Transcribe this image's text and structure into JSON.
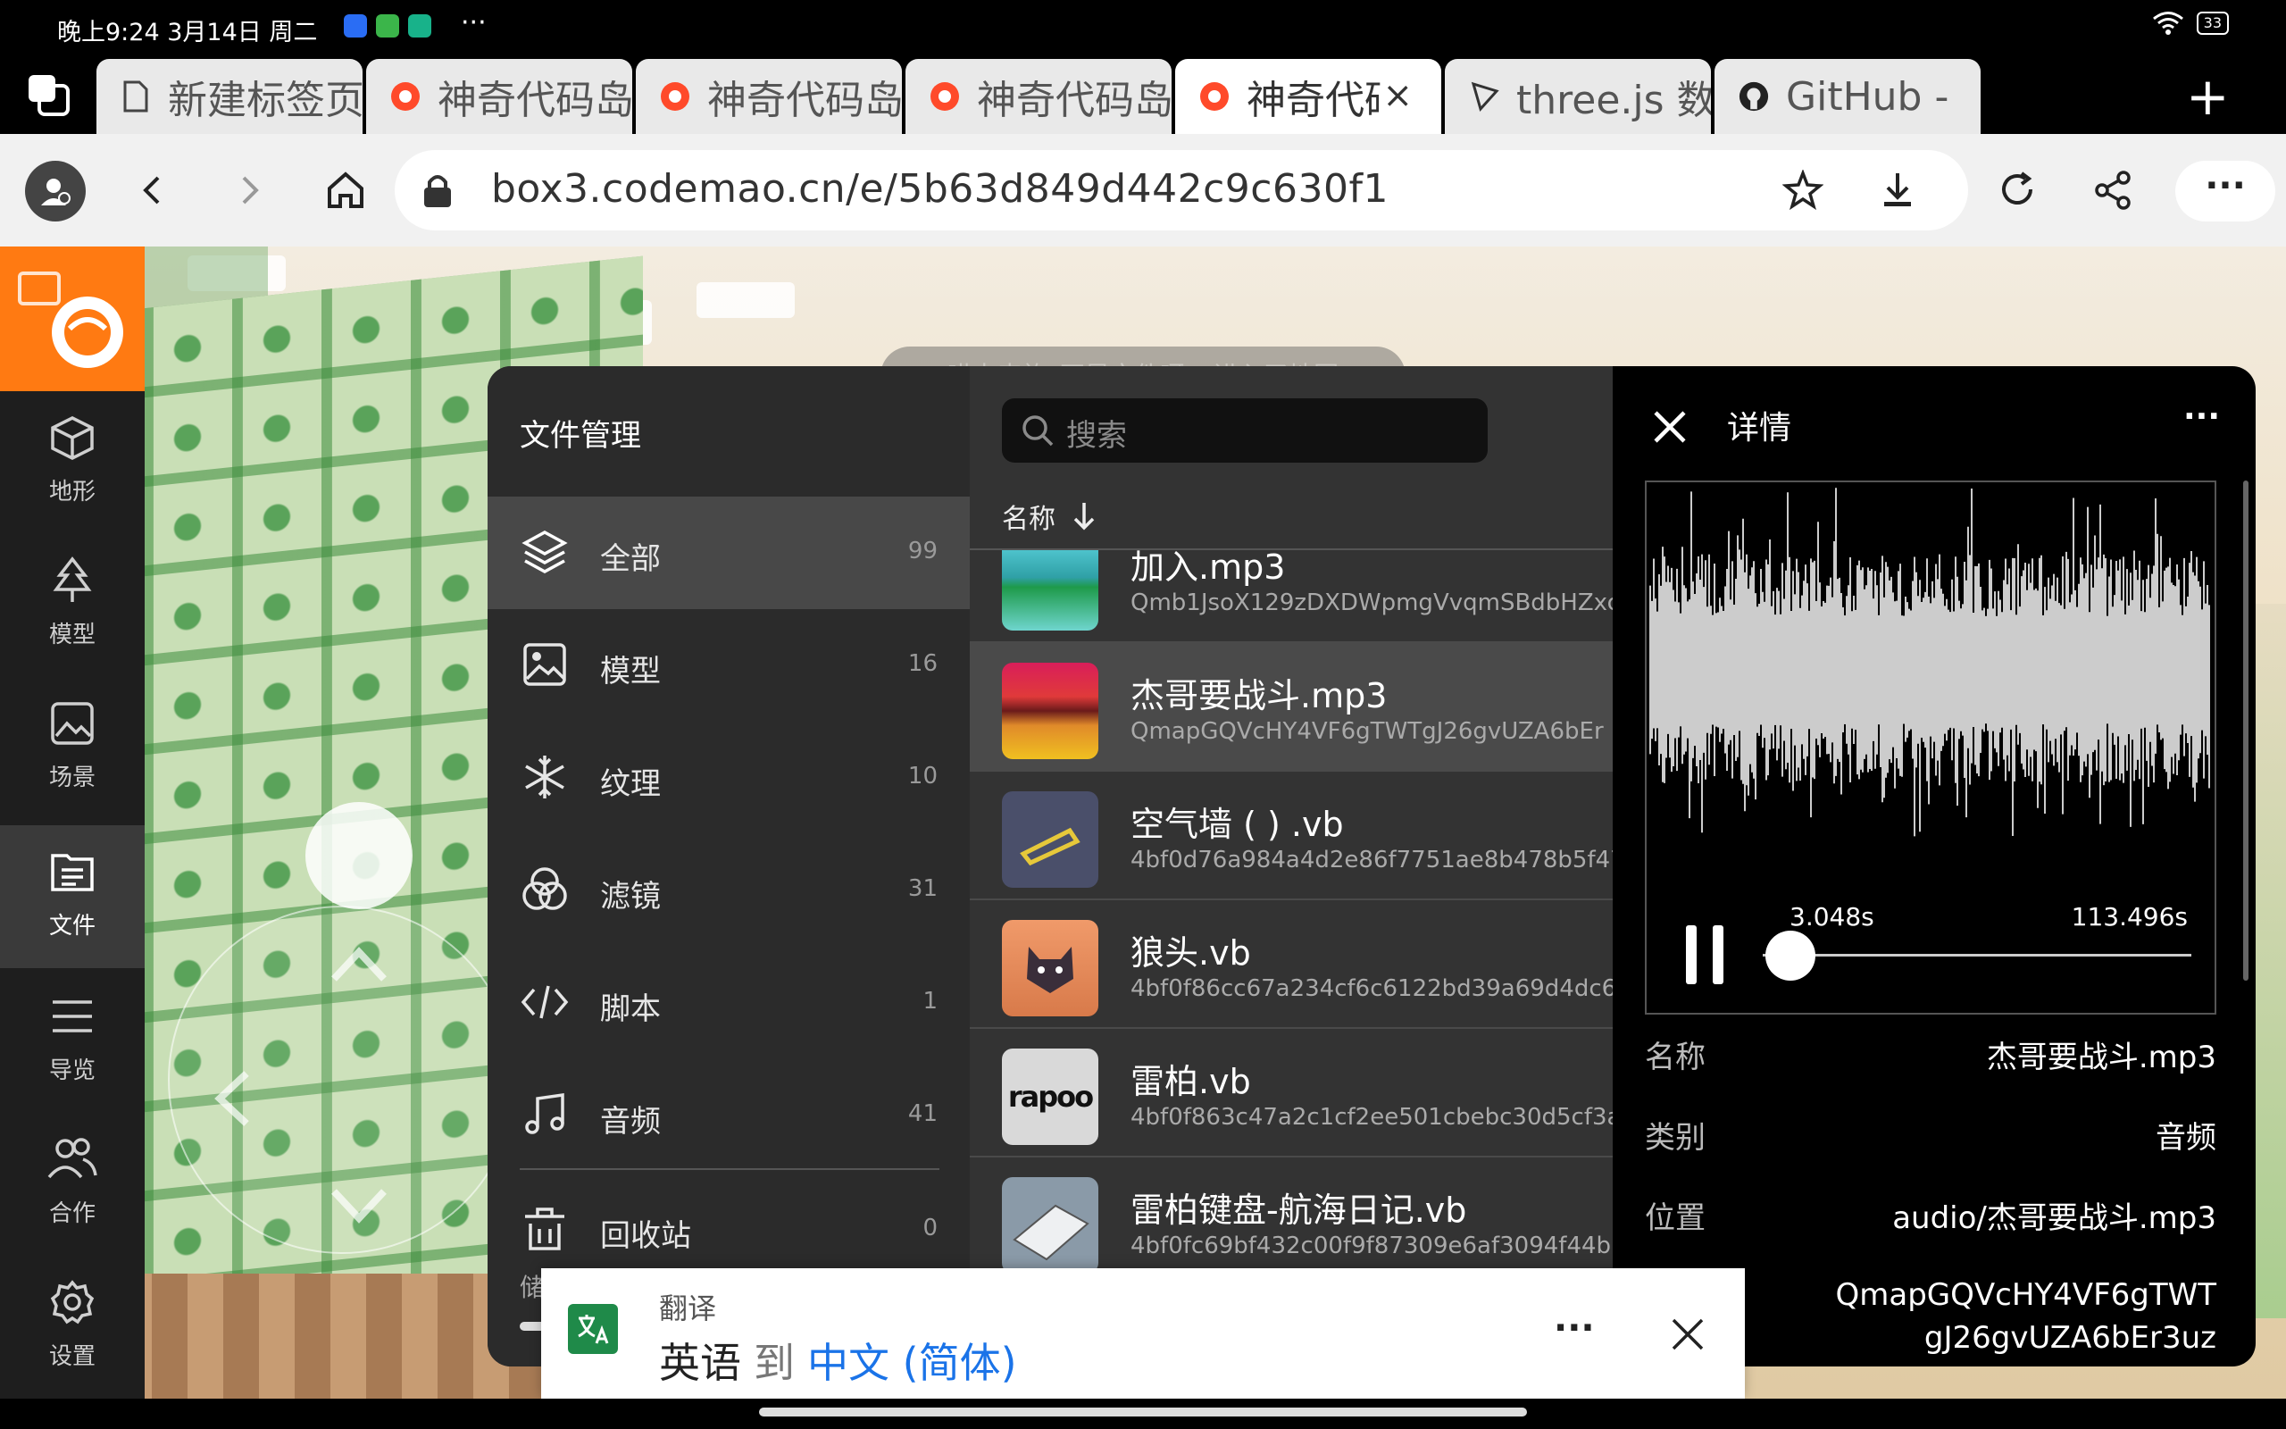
{
  "status_bar": {
    "time": "晚上9:24 3月14日 周二",
    "more": "···",
    "battery": "33",
    "icons": [
      "app-icon-blue",
      "app-icon-green",
      "app-icon-teal",
      "wifi-icon",
      "battery-icon"
    ]
  },
  "tabs": [
    {
      "label": "新建标签页",
      "icon": "page-icon"
    },
    {
      "label": "神奇代码岛",
      "icon": "codemao-icon"
    },
    {
      "label": "神奇代码岛",
      "icon": "codemao-icon"
    },
    {
      "label": "神奇代码岛",
      "icon": "codemao-icon"
    },
    {
      "label": "神奇代码岛",
      "icon": "codemao-icon",
      "active": true
    },
    {
      "label": "three.js 数",
      "icon": "threejs-icon"
    },
    {
      "label": "GitHub - ",
      "icon": "github-icon"
    }
  ],
  "tab_close": "×",
  "new_tab": "+",
  "address": {
    "url": "box3.codemao.cn/e/5b63d849d442c9c630f1"
  },
  "game_sidebar": {
    "items": [
      {
        "label": "地形",
        "icon": "cube-icon"
      },
      {
        "label": "模型",
        "icon": "tree-icon"
      },
      {
        "label": "场景",
        "icon": "image-icon"
      },
      {
        "label": "文件",
        "icon": "file-list-icon",
        "active": true
      },
      {
        "label": "导览",
        "icon": "list-icon"
      },
      {
        "label": "合作",
        "icon": "users-icon"
      },
      {
        "label": "设置",
        "icon": "gear-icon"
      }
    ]
  },
  "toast": "喵卡森族_不是文件呀~ 进入了地图",
  "file_manager": {
    "title": "文件管理",
    "categories": [
      {
        "label": "全部",
        "count": "99",
        "icon": "layers-icon",
        "active": true
      },
      {
        "label": "模型",
        "count": "16",
        "icon": "image-icon"
      },
      {
        "label": "纹理",
        "count": "10",
        "icon": "snowflake-icon"
      },
      {
        "label": "滤镜",
        "count": "31",
        "icon": "filter-icon"
      },
      {
        "label": "脚本",
        "count": "1",
        "icon": "code-icon"
      },
      {
        "label": "音频",
        "count": "41",
        "icon": "music-icon"
      },
      {
        "label": "回收站",
        "count": "0",
        "icon": "trash-icon"
      }
    ],
    "storage_label": "储",
    "search_placeholder": "搜索",
    "sort_label": "名称",
    "files": [
      {
        "name": "加入.mp3",
        "hash": "Qmb1JsoX129zDXDWpmgVvqmSBdbHZxc"
      },
      {
        "name": "杰哥要战斗.mp3",
        "hash": "QmapGQVcHY4VF6gTWTgJ26gvUZA6bEr",
        "selected": true
      },
      {
        "name": "空气墙 ( ) .vb",
        "hash": "4bf0d76a984a4d2e86f7751ae8b478b5f47"
      },
      {
        "name": "狼头.vb",
        "hash": "4bf0f86cc67a234cf6c6122bd39a69d4dc6"
      },
      {
        "name": "雷柏.vb",
        "hash": "4bf0f863c47a2c1cf2ee501cbebc30d5cf3a"
      },
      {
        "name": "雷柏键盘-航海日记.vb",
        "hash": "4bf0fc69bf432c00f9f87309e6af3094f44b"
      }
    ],
    "thumb_labels": {
      "rapoo": "rapoo"
    }
  },
  "detail": {
    "title": "详情",
    "more": "···",
    "current_time": "3.048s",
    "total_time": "113.496s",
    "progress": 0.027,
    "props": [
      {
        "key": "名称",
        "value": "杰哥要战斗.mp3"
      },
      {
        "key": "类别",
        "value": "音频"
      },
      {
        "key": "位置",
        "value": "audio/杰哥要战斗.mp3"
      },
      {
        "key": "",
        "value": "QmapGQVcHY4VF6gTWTgJ26gvUZA6bEr3uz"
      }
    ]
  },
  "translate": {
    "title": "翻译",
    "source": "英语",
    "to": "到",
    "target": "中文 (简体)",
    "more": "···"
  }
}
